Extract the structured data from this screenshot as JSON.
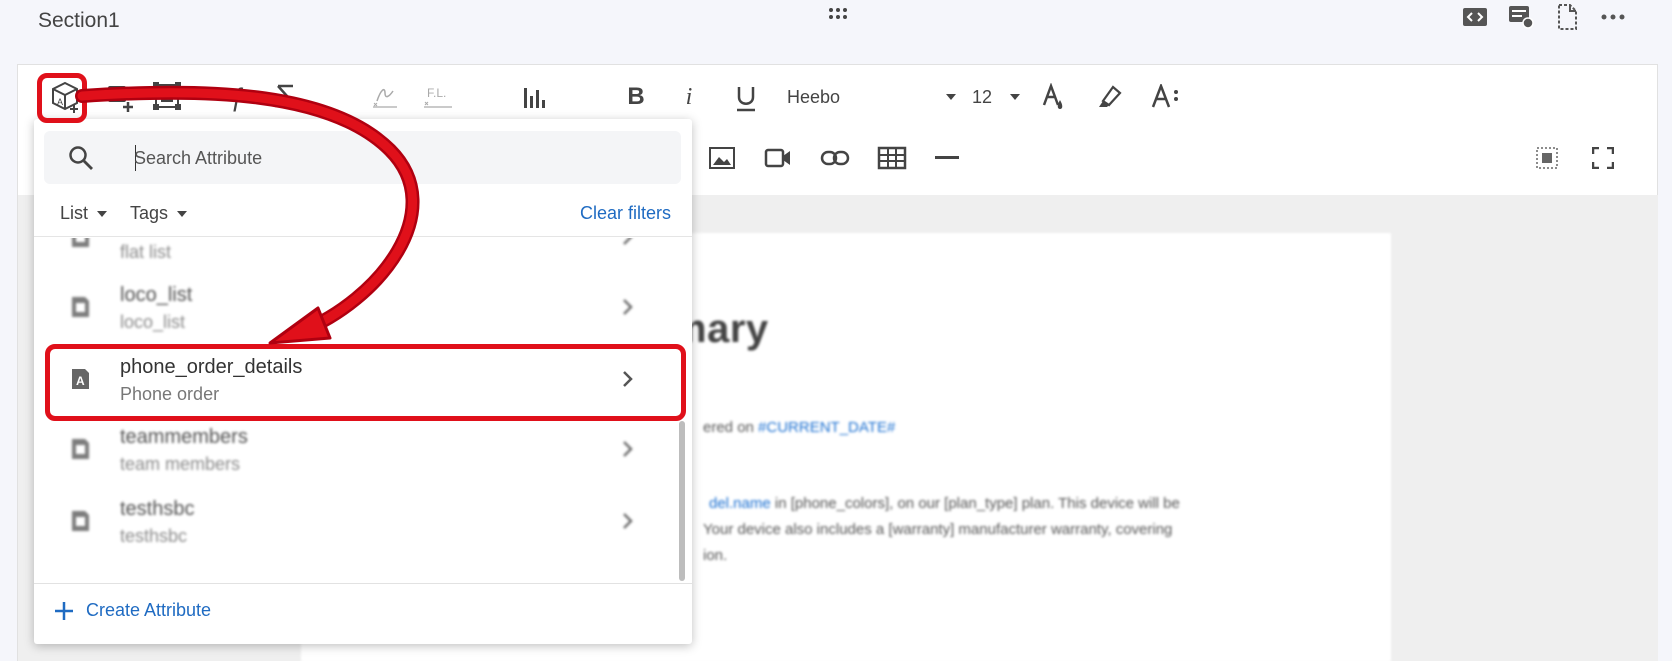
{
  "header": {
    "section_title": "Section1"
  },
  "toolbar": {
    "font_name": "Heebo",
    "font_size": "12"
  },
  "document": {
    "heading": "mary",
    "line_prefix": "ered on ",
    "current_date": "#CURRENT_DATE#",
    "p1_link": "del.name",
    "p1_rest": " in [phone_colors], on our [plan_type] plan. This device will be",
    "p2": " Your device also includes a [warranty] manufacturer warranty, covering",
    "p3": "ion."
  },
  "dropdown": {
    "search_placeholder": "Search Attribute",
    "filter_list": "List",
    "filter_tags": "Tags",
    "clear_filters": "Clear filters",
    "items": [
      {
        "name": "",
        "sub": "flat list"
      },
      {
        "name": "loco_list",
        "sub": "loco_list"
      },
      {
        "name": "phone_order_details",
        "sub": "Phone order"
      },
      {
        "name": "teammembers",
        "sub": "team members"
      },
      {
        "name": "testhsbc",
        "sub": "testhsbc"
      }
    ],
    "create_label": "Create Attribute"
  },
  "colors": {
    "highlight": "#e0101a",
    "link": "#1f6bc2"
  }
}
